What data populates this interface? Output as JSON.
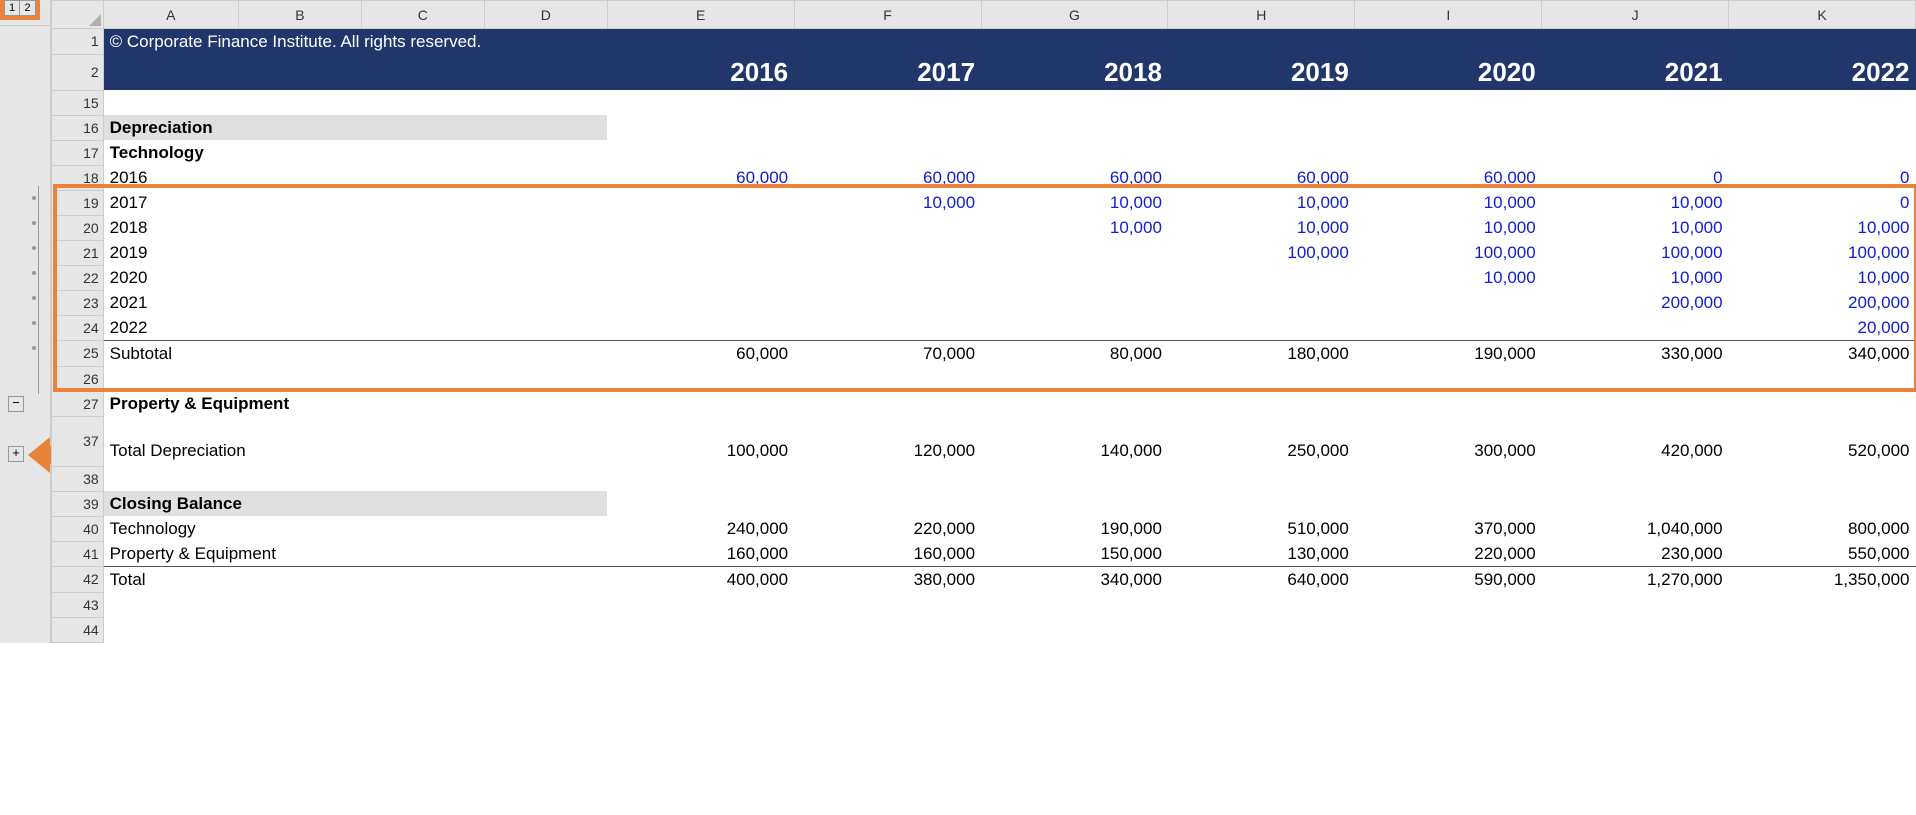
{
  "outline": {
    "level1": "1",
    "level2": "2",
    "minus": "−",
    "plus": "+"
  },
  "columns": [
    "A",
    "B",
    "C",
    "D",
    "E",
    "F",
    "G",
    "H",
    "I",
    "J",
    "K"
  ],
  "header": {
    "copyright": "© Corporate Finance Institute. All rights reserved.",
    "years": [
      "2016",
      "2017",
      "2018",
      "2019",
      "2020",
      "2021",
      "2022"
    ]
  },
  "rows": {
    "r15": "15",
    "r16": {
      "num": "16",
      "label": "Depreciation"
    },
    "r17": {
      "num": "17",
      "label": "Technology"
    },
    "r18": {
      "num": "18",
      "label": "2016",
      "vals": [
        "60,000",
        "60,000",
        "60,000",
        "60,000",
        "60,000",
        "0",
        "0"
      ]
    },
    "r19": {
      "num": "19",
      "label": "2017",
      "vals": [
        "",
        "10,000",
        "10,000",
        "10,000",
        "10,000",
        "10,000",
        "0"
      ]
    },
    "r20": {
      "num": "20",
      "label": "2018",
      "vals": [
        "",
        "",
        "10,000",
        "10,000",
        "10,000",
        "10,000",
        "10,000"
      ]
    },
    "r21": {
      "num": "21",
      "label": "2019",
      "vals": [
        "",
        "",
        "",
        "100,000",
        "100,000",
        "100,000",
        "100,000"
      ]
    },
    "r22": {
      "num": "22",
      "label": "2020",
      "vals": [
        "",
        "",
        "",
        "",
        "10,000",
        "10,000",
        "10,000"
      ]
    },
    "r23": {
      "num": "23",
      "label": "2021",
      "vals": [
        "",
        "",
        "",
        "",
        "",
        "200,000",
        "200,000"
      ]
    },
    "r24": {
      "num": "24",
      "label": "2022",
      "vals": [
        "",
        "",
        "",
        "",
        "",
        "",
        "20,000"
      ]
    },
    "r25": {
      "num": "25",
      "label": "Subtotal",
      "vals": [
        "60,000",
        "70,000",
        "80,000",
        "180,000",
        "190,000",
        "330,000",
        "340,000"
      ]
    },
    "r26": "26",
    "r27": {
      "num": "27",
      "label": "Property & Equipment"
    },
    "r37": {
      "num": "37",
      "label": "Total Depreciation",
      "vals": [
        "100,000",
        "120,000",
        "140,000",
        "250,000",
        "300,000",
        "420,000",
        "520,000"
      ]
    },
    "r38": "38",
    "r39": {
      "num": "39",
      "label": "Closing Balance"
    },
    "r40": {
      "num": "40",
      "label": "Technology",
      "vals": [
        "240,000",
        "220,000",
        "190,000",
        "510,000",
        "370,000",
        "1,040,000",
        "800,000"
      ]
    },
    "r41": {
      "num": "41",
      "label": "Property & Equipment",
      "vals": [
        "160,000",
        "160,000",
        "150,000",
        "130,000",
        "220,000",
        "230,000",
        "550,000"
      ]
    },
    "r42": {
      "num": "42",
      "label": "Total",
      "vals": [
        "400,000",
        "380,000",
        "340,000",
        "640,000",
        "590,000",
        "1,270,000",
        "1,350,000"
      ]
    },
    "r43": "43",
    "r44": "44"
  }
}
